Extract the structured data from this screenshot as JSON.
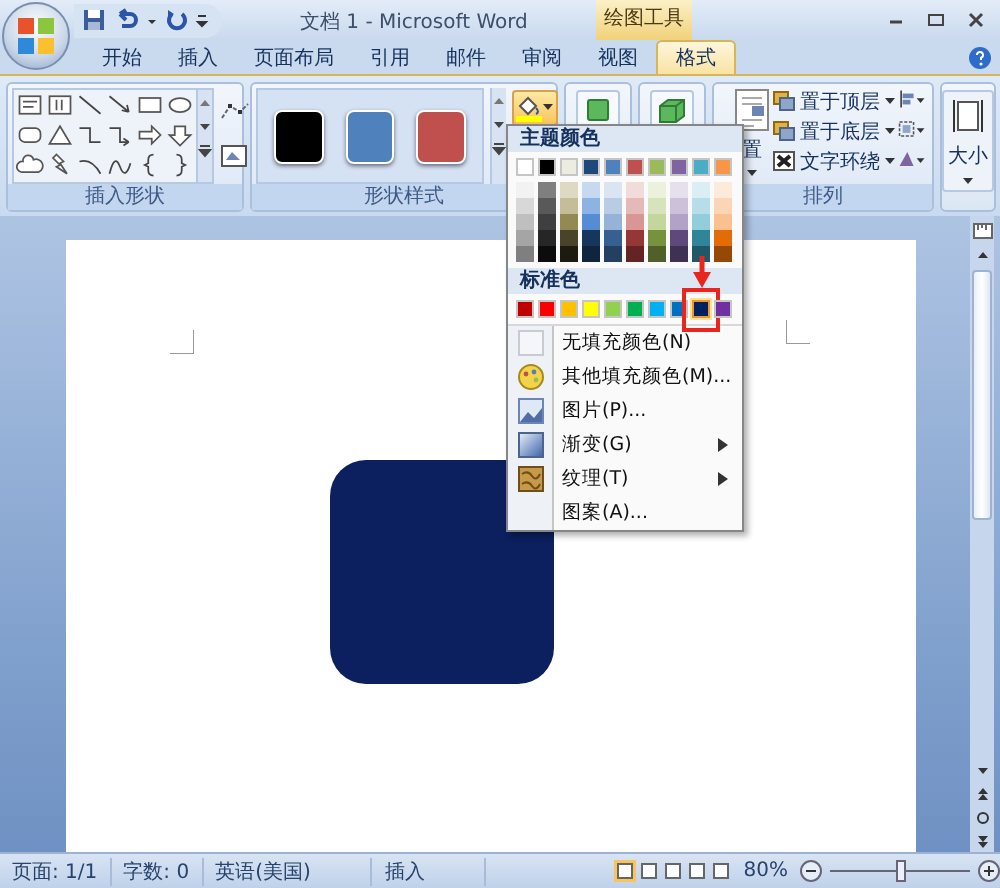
{
  "title_bar": {
    "title": "文档 1 - Microsoft Word",
    "context_tab": "绘图工具"
  },
  "tabs": [
    {
      "label": "开始",
      "selected": false
    },
    {
      "label": "插入",
      "selected": false
    },
    {
      "label": "页面布局",
      "selected": false
    },
    {
      "label": "引用",
      "selected": false
    },
    {
      "label": "邮件",
      "selected": false
    },
    {
      "label": "审阅",
      "selected": false
    },
    {
      "label": "视图",
      "selected": false
    },
    {
      "label": "格式",
      "selected": true
    }
  ],
  "ribbon": {
    "insert_shapes": {
      "label": "插入形状"
    },
    "shape_styles": {
      "label": "形状样式",
      "presets": [
        {
          "color": "#000000"
        },
        {
          "color": "#4f81bd"
        },
        {
          "color": "#c0504d"
        }
      ]
    },
    "arrange": {
      "label": "排列",
      "position_label": "置",
      "items": [
        "置于顶层",
        "置于底层",
        "文字环绕"
      ]
    },
    "size": {
      "label": "大小"
    }
  },
  "fill_menu": {
    "theme_header": "主题颜色",
    "theme_colors": [
      {
        "color": "#ffffff",
        "shades": [
          {
            "color": "#f2f2f2"
          },
          {
            "color": "#d8d8d8"
          },
          {
            "color": "#bfbfbf"
          },
          {
            "color": "#a5a5a5"
          },
          {
            "color": "#7f7f7f"
          }
        ]
      },
      {
        "color": "#000000",
        "shades": [
          {
            "color": "#7f7f7f"
          },
          {
            "color": "#595959"
          },
          {
            "color": "#3f3f3f"
          },
          {
            "color": "#262626"
          },
          {
            "color": "#0c0c0c"
          }
        ]
      },
      {
        "color": "#eeece1",
        "shades": [
          {
            "color": "#ddd9c3"
          },
          {
            "color": "#c4bd97"
          },
          {
            "color": "#938953"
          },
          {
            "color": "#494429"
          },
          {
            "color": "#1d1b10"
          }
        ]
      },
      {
        "color": "#1f497d",
        "shades": [
          {
            "color": "#c6d9f0"
          },
          {
            "color": "#8db3e2"
          },
          {
            "color": "#548dd4"
          },
          {
            "color": "#17365d"
          },
          {
            "color": "#0f243e"
          }
        ]
      },
      {
        "color": "#4f81bd",
        "shades": [
          {
            "color": "#dbe5f1"
          },
          {
            "color": "#b8cce4"
          },
          {
            "color": "#95b3d7"
          },
          {
            "color": "#366092"
          },
          {
            "color": "#244061"
          }
        ]
      },
      {
        "color": "#c0504d",
        "shades": [
          {
            "color": "#f2dcdb"
          },
          {
            "color": "#e5b9b7"
          },
          {
            "color": "#d99694"
          },
          {
            "color": "#953734"
          },
          {
            "color": "#632423"
          }
        ]
      },
      {
        "color": "#9bbb59",
        "shades": [
          {
            "color": "#ebf1dd"
          },
          {
            "color": "#d7e3bc"
          },
          {
            "color": "#c3d69b"
          },
          {
            "color": "#76923c"
          },
          {
            "color": "#4f6128"
          }
        ]
      },
      {
        "color": "#8064a2",
        "shades": [
          {
            "color": "#e5e0ec"
          },
          {
            "color": "#ccc1d9"
          },
          {
            "color": "#b2a2c7"
          },
          {
            "color": "#5f497a"
          },
          {
            "color": "#3f3151"
          }
        ]
      },
      {
        "color": "#4bacc6",
        "shades": [
          {
            "color": "#dbeef3"
          },
          {
            "color": "#b7dde8"
          },
          {
            "color": "#92cddc"
          },
          {
            "color": "#31859b"
          },
          {
            "color": "#205867"
          }
        ]
      },
      {
        "color": "#f79646",
        "shades": [
          {
            "color": "#fdeada"
          },
          {
            "color": "#fbd5b5"
          },
          {
            "color": "#fac08f"
          },
          {
            "color": "#e36c09"
          },
          {
            "color": "#974806"
          }
        ]
      }
    ],
    "standard_header": "标准色",
    "standard_colors": [
      {
        "color": "#c00000",
        "selected": false
      },
      {
        "color": "#ff0000",
        "selected": false
      },
      {
        "color": "#ffc000",
        "selected": false
      },
      {
        "color": "#ffff00",
        "selected": false
      },
      {
        "color": "#92d050",
        "selected": false
      },
      {
        "color": "#00b050",
        "selected": false
      },
      {
        "color": "#00b0f0",
        "selected": false
      },
      {
        "color": "#0070c0",
        "selected": false
      },
      {
        "color": "#002060",
        "selected": true
      },
      {
        "color": "#7030a0",
        "selected": false
      }
    ],
    "items": [
      {
        "label": "无填充颜色(N)",
        "kind": "none",
        "submenu": false
      },
      {
        "label": "其他填充颜色(M)...",
        "kind": "more",
        "submenu": false
      },
      {
        "label": "图片(P)...",
        "kind": "picture",
        "submenu": false
      },
      {
        "label": "渐变(G)",
        "kind": "gradient",
        "submenu": true
      },
      {
        "label": "纹理(T)",
        "kind": "texture",
        "submenu": true
      },
      {
        "label": "图案(A)...",
        "kind": "pattern",
        "submenu": false
      }
    ]
  },
  "document": {
    "shape": {
      "color": "#0c1f5e"
    }
  },
  "status_bar": {
    "page": "页面: 1/1",
    "words": "字数: 0",
    "language": "英语(美国)",
    "mode": "插入",
    "zoom": "80%",
    "zoom_slider": {
      "level": 0.5
    },
    "views": [
      {
        "selected": true
      },
      {
        "selected": false
      },
      {
        "selected": false
      },
      {
        "selected": false
      },
      {
        "selected": false
      }
    ]
  }
}
